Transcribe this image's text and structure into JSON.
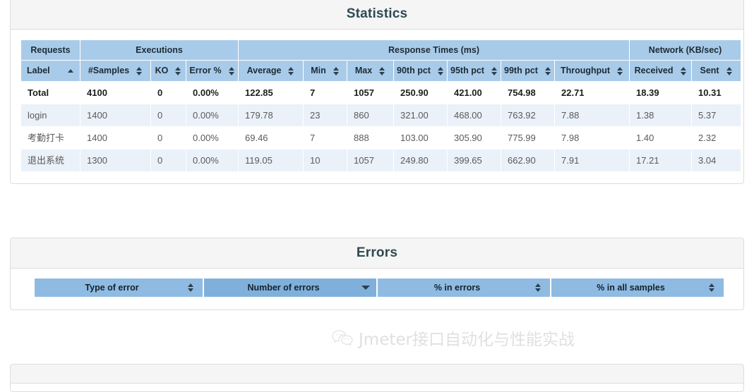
{
  "statistics": {
    "title": "Statistics",
    "group_headers": [
      {
        "label": "Requests",
        "span": 1
      },
      {
        "label": "Executions",
        "span": 3
      },
      {
        "label": "Response Times (ms)",
        "span": 7
      },
      {
        "label": "Network (KB/sec)",
        "span": 2
      }
    ],
    "columns": [
      {
        "label": "Label",
        "sort": "asc",
        "align": "left"
      },
      {
        "label": "#Samples",
        "sort": "both",
        "align": "center"
      },
      {
        "label": "KO",
        "sort": "both",
        "align": "center"
      },
      {
        "label": "Error %",
        "sort": "both",
        "align": "center"
      },
      {
        "label": "Average",
        "sort": "both",
        "align": "center"
      },
      {
        "label": "Min",
        "sort": "both",
        "align": "center"
      },
      {
        "label": "Max",
        "sort": "both",
        "align": "center"
      },
      {
        "label": "90th pct",
        "sort": "both",
        "align": "center"
      },
      {
        "label": "95th pct",
        "sort": "both",
        "align": "center"
      },
      {
        "label": "99th pct",
        "sort": "both",
        "align": "center"
      },
      {
        "label": "Throughput",
        "sort": "both",
        "align": "center"
      },
      {
        "label": "Received",
        "sort": "both",
        "align": "center"
      },
      {
        "label": "Sent",
        "sort": "both",
        "align": "center"
      }
    ],
    "rows": [
      {
        "type": "total",
        "label": "Total",
        "samples": "4100",
        "ko": "0",
        "error_pct": "0.00%",
        "average": "122.85",
        "min": "7",
        "max": "1057",
        "pct90": "250.90",
        "pct95": "421.00",
        "pct99": "754.98",
        "throughput": "22.71",
        "received": "18.39",
        "sent": "10.31"
      },
      {
        "type": "data",
        "label": "login",
        "samples": "1400",
        "ko": "0",
        "error_pct": "0.00%",
        "average": "179.78",
        "min": "23",
        "max": "860",
        "pct90": "321.00",
        "pct95": "468.00",
        "pct99": "763.92",
        "throughput": "7.88",
        "received": "1.38",
        "sent": "5.37"
      },
      {
        "type": "data",
        "label": "考勤打卡",
        "samples": "1400",
        "ko": "0",
        "error_pct": "0.00%",
        "average": "69.46",
        "min": "7",
        "max": "888",
        "pct90": "103.00",
        "pct95": "305.90",
        "pct99": "775.99",
        "throughput": "7.98",
        "received": "1.40",
        "sent": "2.32"
      },
      {
        "type": "data",
        "label": "退出系统",
        "samples": "1300",
        "ko": "0",
        "error_pct": "0.00%",
        "average": "119.05",
        "min": "10",
        "max": "1057",
        "pct90": "249.80",
        "pct95": "399.65",
        "pct99": "662.90",
        "throughput": "7.91",
        "received": "17.21",
        "sent": "3.04"
      }
    ]
  },
  "errors": {
    "title": "Errors",
    "columns": [
      {
        "label": "Type of error",
        "sort": "both",
        "active": false
      },
      {
        "label": "Number of errors",
        "sort": "desc",
        "active": true
      },
      {
        "label": "% in errors",
        "sort": "both",
        "active": false
      },
      {
        "label": "% in all samples",
        "sort": "both",
        "active": false
      }
    ],
    "rows": []
  },
  "watermark": {
    "icon": "wechat-icon",
    "text": "Jmeter接口自动化与性能实战"
  },
  "colors": {
    "header_blue": "#a9cbea",
    "errors_header_blue": "#8fbbe2",
    "errors_header_active": "#7fb0db",
    "row_odd": "#eaf1f9",
    "panel_heading": "#f5f5f5",
    "title_text": "#2d4a52"
  }
}
